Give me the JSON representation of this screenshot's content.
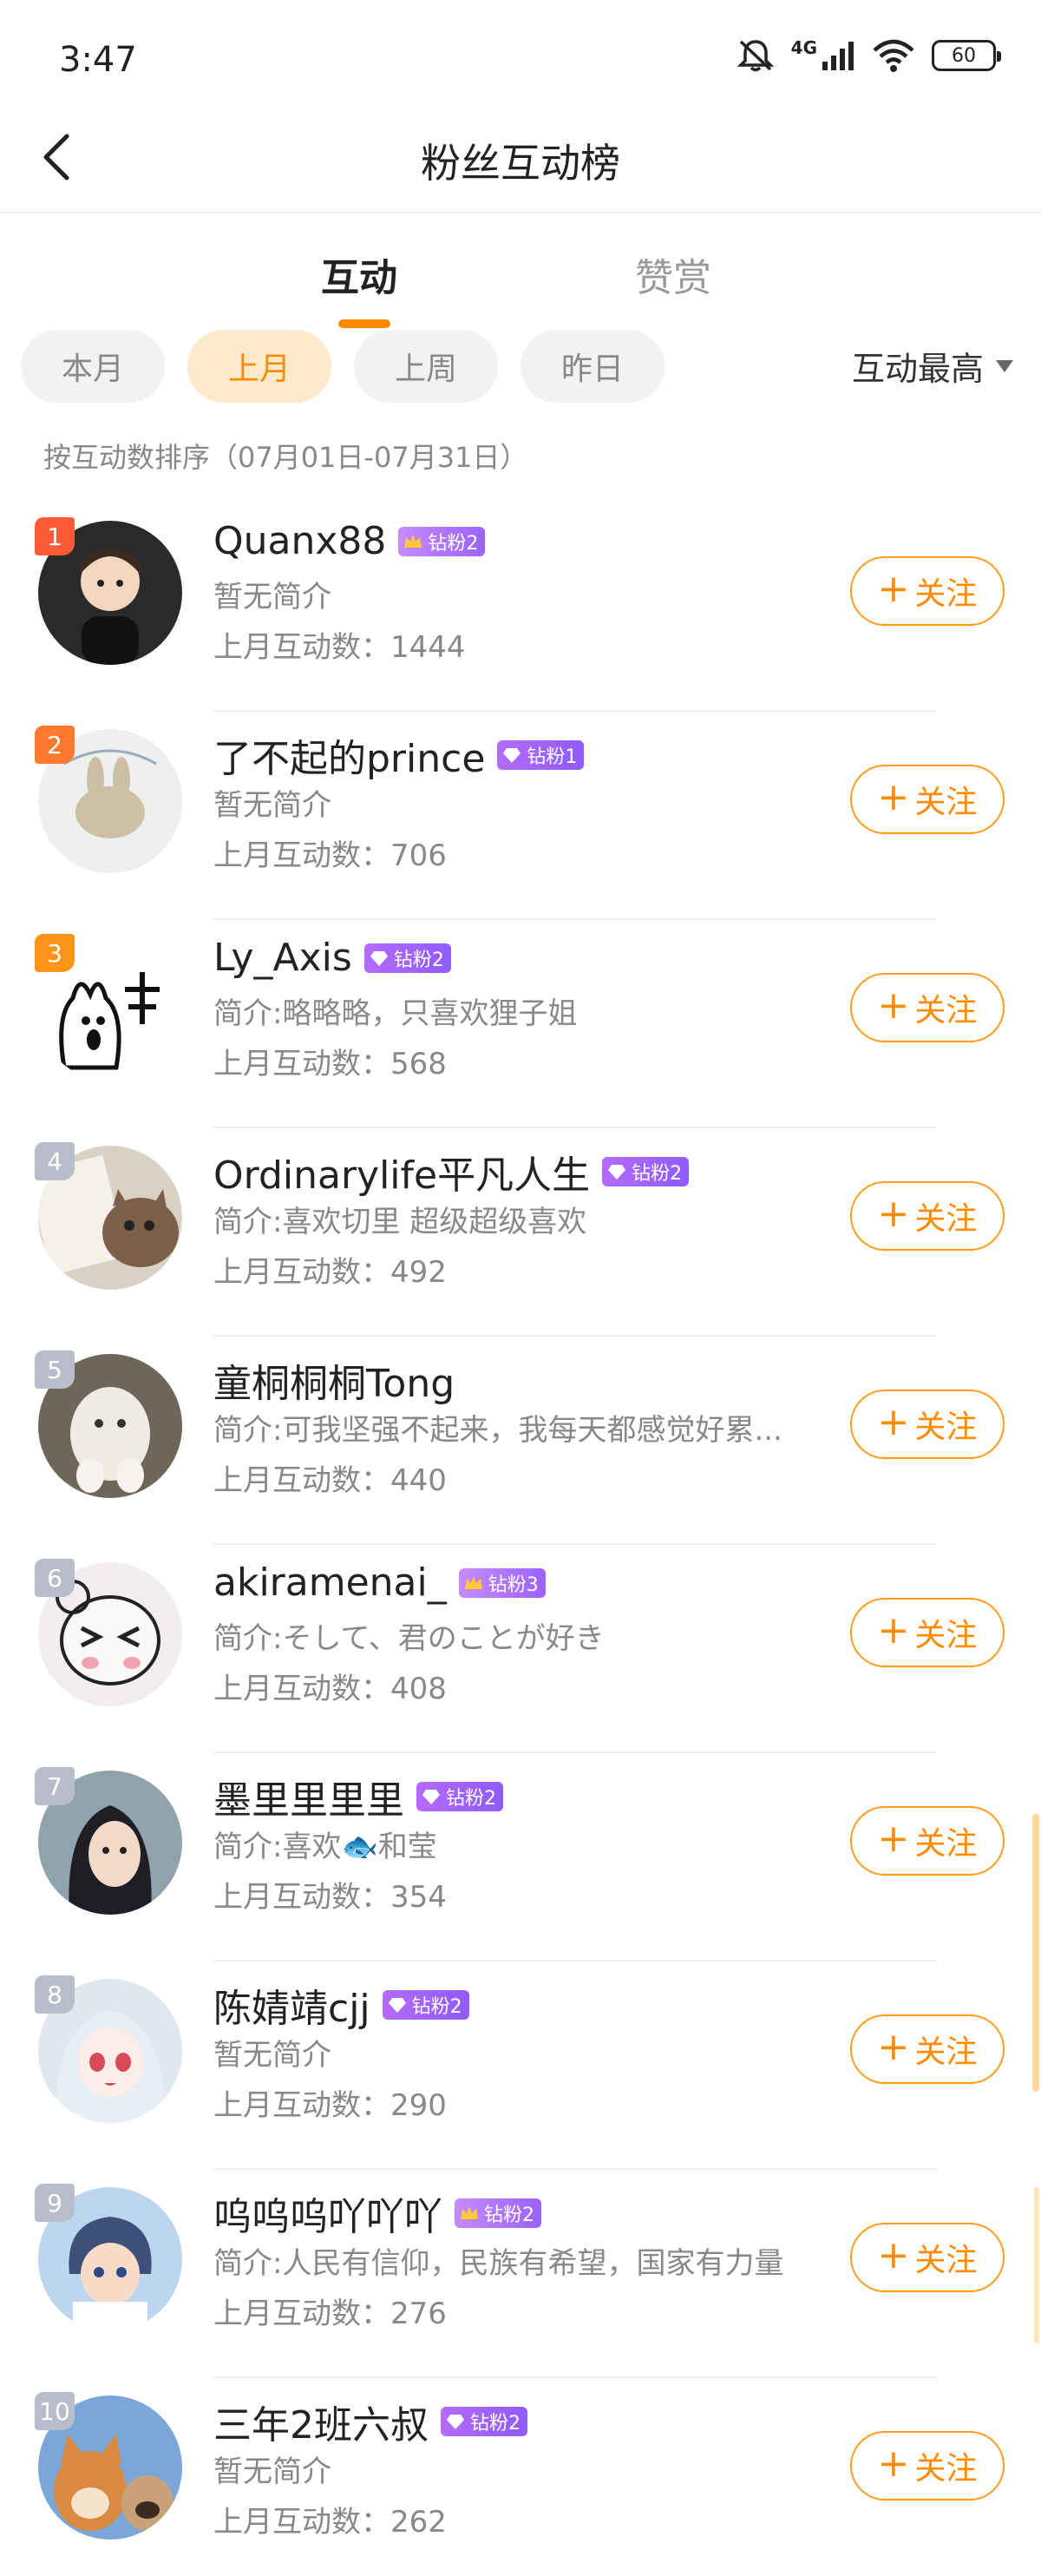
{
  "status_bar": {
    "time": "3:47",
    "network": "4G",
    "battery": "60"
  },
  "nav": {
    "title": "粉丝互动榜"
  },
  "tabs": [
    {
      "label": "互动"
    },
    {
      "label": "赞赏"
    }
  ],
  "filters": [
    {
      "label": "本月"
    },
    {
      "label": "上月"
    },
    {
      "label": "上周"
    },
    {
      "label": "昨日"
    }
  ],
  "sort": {
    "label": "互动最高"
  },
  "sort_desc": "按互动数排序（07月01日-07月31日）",
  "colors": {
    "accent": "#ff8a00",
    "badge": "#9b5cff",
    "rank_top": "#ff5a36",
    "rank_rest": "#b8bccb"
  },
  "follow_label": "关注",
  "fans": [
    {
      "rank": "1",
      "name": "Quanx88",
      "badge": "钻粉2",
      "badge_icon": "crown-icon",
      "bio": "暂无简介",
      "count": "上月互动数：1444"
    },
    {
      "rank": "2",
      "name": "了不起的prince",
      "badge": "钻粉1",
      "badge_icon": "diamond-icon",
      "bio": "暂无简介",
      "count": "上月互动数：706"
    },
    {
      "rank": "3",
      "name": "Ly_Axis",
      "badge": "钻粉2",
      "badge_icon": "diamond-icon",
      "bio": "简介:略略略，只喜欢狸子姐",
      "count": "上月互动数：568"
    },
    {
      "rank": "4",
      "name": "Ordinarylife平凡人生",
      "badge": "钻粉2",
      "badge_icon": "diamond-icon",
      "bio": "简介:喜欢切里 超级超级喜欢",
      "count": "上月互动数：492"
    },
    {
      "rank": "5",
      "name": "童桐桐桐Tong",
      "badge": "",
      "badge_icon": "",
      "bio": "简介:可我坚强不起来，我每天都感觉好累...",
      "count": "上月互动数：440"
    },
    {
      "rank": "6",
      "name": "akiramenai_",
      "badge": "钻粉3",
      "badge_icon": "crown-icon",
      "bio": "简介:そして、君のことが好き",
      "count": "上月互动数：408"
    },
    {
      "rank": "7",
      "name": "墨里里里里",
      "badge": "钻粉2",
      "badge_icon": "diamond-icon",
      "bio": "简介:喜欢🐟和莹",
      "count": "上月互动数：354"
    },
    {
      "rank": "8",
      "name": "陈婧靖cjj",
      "badge": "钻粉2",
      "badge_icon": "diamond-icon",
      "bio": "暂无简介",
      "count": "上月互动数：290"
    },
    {
      "rank": "9",
      "name": "呜呜呜吖吖吖",
      "badge": "钻粉2",
      "badge_icon": "crown-icon",
      "bio": "简介:人民有信仰，民族有希望，国家有力量",
      "count": "上月互动数：276"
    },
    {
      "rank": "10",
      "name": "三年2班六叔",
      "badge": "钻粉2",
      "badge_icon": "diamond-icon",
      "bio": "暂无简介",
      "count": "上月互动数：262"
    }
  ]
}
